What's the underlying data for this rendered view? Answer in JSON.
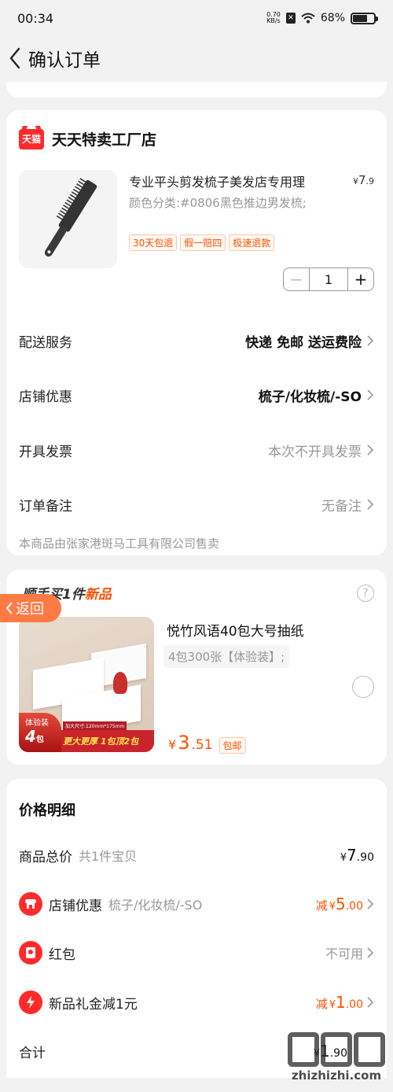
{
  "status_bar": {
    "time": "00:34",
    "net_speed_value": "0.70",
    "net_speed_unit": "KB/s",
    "battery": "68%",
    "battery_level": 0.68
  },
  "nav": {
    "title": "确认订单"
  },
  "order": {
    "shop": {
      "platform_logo": "天猫",
      "name": "天天特卖工厂店"
    },
    "product": {
      "title": "专业平头剪发梳子美发店专用理",
      "price_yen": "¥",
      "price_int": "7",
      "price_dec": ".9",
      "sku": "颜色分类:#0806黑色推边男发梳;",
      "tags": [
        "30天包退",
        "假一赔四",
        "极速退款"
      ],
      "quantity": "1",
      "minus": "−",
      "plus": "+"
    },
    "rows": [
      {
        "label": "配送服务",
        "value": "快递 免邮 送运费险"
      },
      {
        "label": "店铺优惠",
        "value": "梳子/化妆梳/-SO"
      },
      {
        "label": "开具发票",
        "value": "本次不开具发票"
      },
      {
        "label": "订单备注",
        "value": "无备注"
      }
    ],
    "seller_note": "本商品由张家港斑马工具有限公司售卖"
  },
  "recommend": {
    "header_prefix": "顺手买1件",
    "header_accent": "新品",
    "help": "?",
    "back_label": "返回",
    "product": {
      "title": "悦竹风语40包大号抽纸",
      "sku": "4包300张【体验装】;",
      "image_badge_top": "体验装",
      "image_badge_num": "4",
      "image_badge_unit": "包",
      "image_size_text": "加大尺寸:120mm*175mm",
      "image_slogan": "更大更厚 1包顶2包",
      "price_yen": "¥",
      "price_int": "3",
      "price_dec": ".51",
      "price_tag": "包邮"
    }
  },
  "price_detail": {
    "title": "价格明细",
    "rows": [
      {
        "label": "商品总价",
        "sub": "共1件宝贝",
        "prefix": "",
        "yen": "¥",
        "int": "7",
        "dec": ".90"
      },
      {
        "label": "店铺优惠",
        "sub": "梳子/化妆梳/-SO",
        "prefix": "减",
        "yen": "¥",
        "int": "5",
        "dec": ".00"
      },
      {
        "label": "红包",
        "sub": "",
        "value": "不可用"
      },
      {
        "label": "新品礼金减1元",
        "sub": "",
        "prefix": "减",
        "yen": "¥",
        "int": "1",
        "dec": ".00"
      },
      {
        "label": "合计",
        "sub": "",
        "prefix": "",
        "yen": "¥",
        "int": "1",
        "dec": ".90"
      }
    ]
  },
  "watermark": {
    "text": "zhizhizhi.com"
  },
  "colors": {
    "accent": "#ff5000",
    "tmall_red": "#ff2a2a",
    "back_pill": "#ff7a45",
    "page_bg": "#f2f2f2"
  }
}
